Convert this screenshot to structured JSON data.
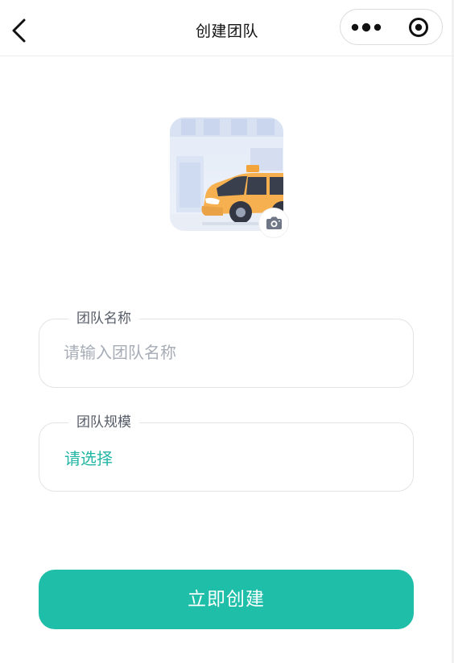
{
  "navbar": {
    "title": "创建团队"
  },
  "avatar": {
    "alt": "taxi avatar"
  },
  "form": {
    "team_name": {
      "label": "团队名称",
      "placeholder": "请输入团队名称"
    },
    "team_size": {
      "label": "团队规模",
      "value": "请选择"
    }
  },
  "submit": {
    "label": "立即创建"
  },
  "colors": {
    "accent": "#1fbea8",
    "select_text": "#22b6a4",
    "taxi_body": "#f6b04f"
  },
  "icons": {
    "back": "chevron-left-icon",
    "more": "more-dots-icon",
    "close": "target-circle-icon",
    "camera": "camera-icon"
  }
}
